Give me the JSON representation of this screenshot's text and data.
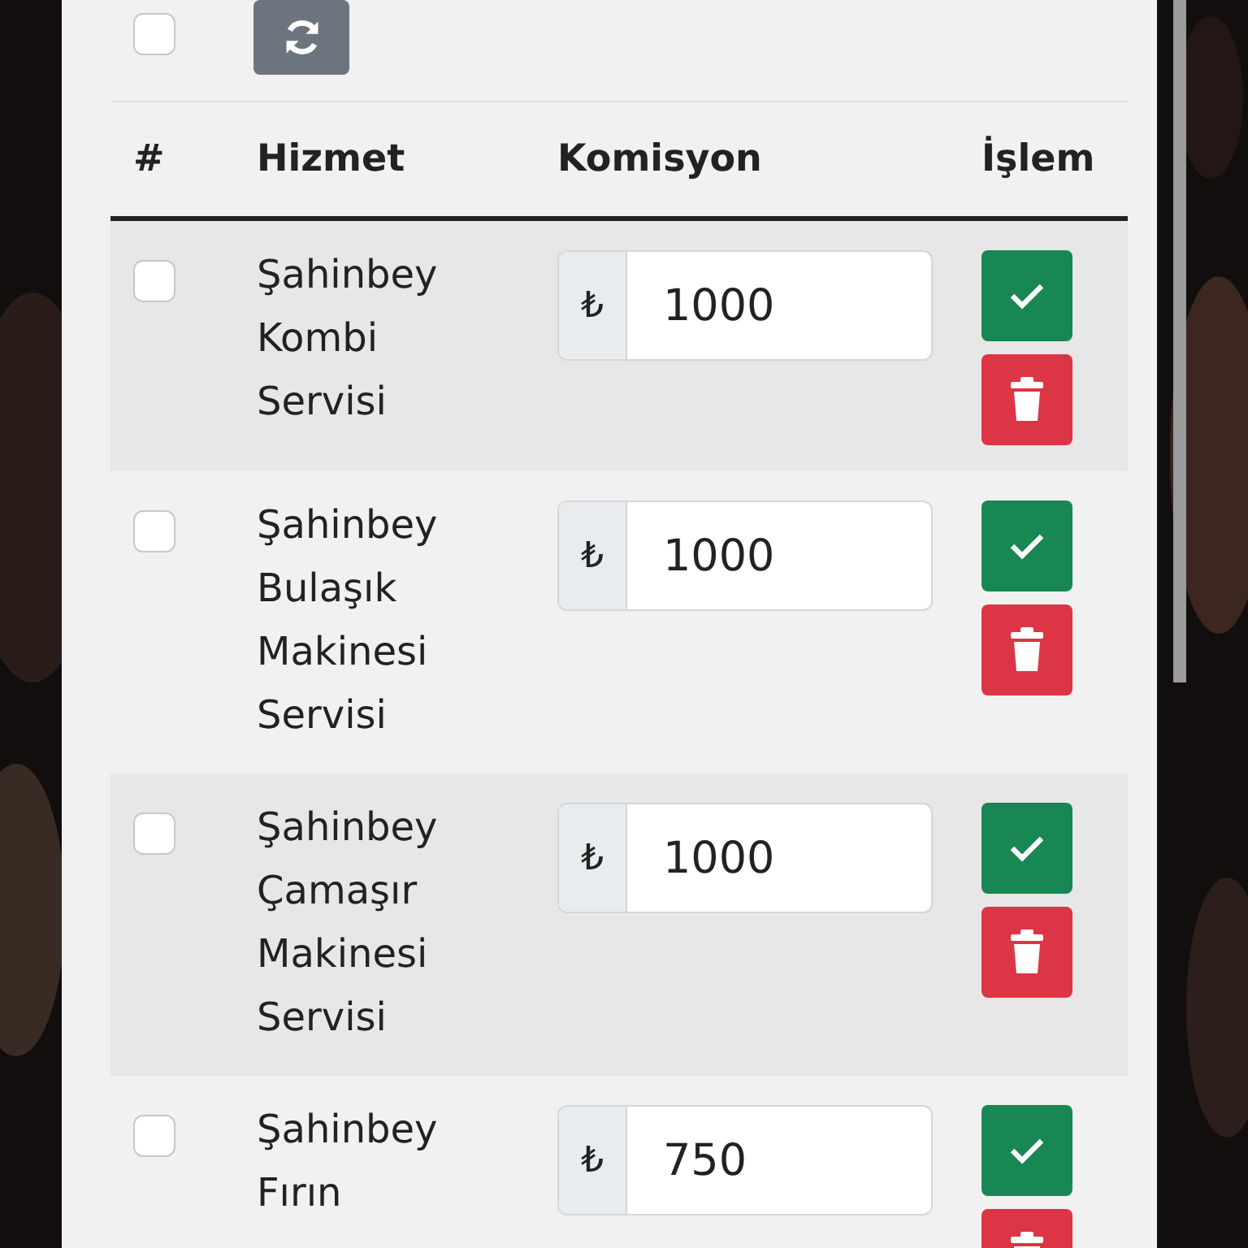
{
  "toolbar": {
    "select_all": {
      "checked": false
    }
  },
  "table": {
    "columns": [
      "#",
      "Hizmet",
      "Komisyon",
      "İşlem"
    ],
    "rows": [
      {
        "checked": false,
        "name": "Şahinbey Kombi Servisi",
        "currency": "₺",
        "value": "1000"
      },
      {
        "checked": false,
        "name": "Şahinbey Bulaşık Makinesi Servisi",
        "currency": "₺",
        "value": "1000"
      },
      {
        "checked": false,
        "name": "Şahinbey Çamaşır Makinesi Servisi",
        "currency": "₺",
        "value": "1000"
      },
      {
        "checked": false,
        "name": "Şahinbey Fırın",
        "currency": "₺",
        "value": "750"
      }
    ]
  }
}
